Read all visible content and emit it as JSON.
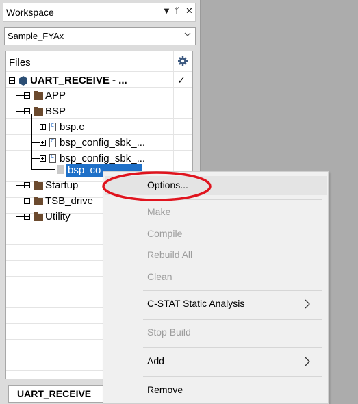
{
  "workspace": {
    "title": "Workspace",
    "controls": [
      "▼",
      "ᛘ",
      "✕"
    ],
    "config_value": "Sample_FYAx"
  },
  "files_panel": {
    "header": "Files",
    "gear_icon": "gear-icon",
    "project": {
      "label": "UART_RECEIVE - ...",
      "check": "✓"
    },
    "tree": [
      {
        "label": "APP"
      },
      {
        "label": "BSP"
      },
      {
        "label": "bsp.c"
      },
      {
        "label": "bsp_config_sbk_..."
      },
      {
        "label": "bsp_config_sbk_..."
      },
      {
        "label": "bsp_co"
      },
      {
        "label": "Startup"
      },
      {
        "label": "TSB_drive"
      },
      {
        "label": "Utility"
      }
    ]
  },
  "bottom_tab": {
    "label": "UART_RECEIVE"
  },
  "context_menu": {
    "items": [
      {
        "label": "Options...",
        "enabled": true
      },
      {
        "label": "Make",
        "enabled": false
      },
      {
        "label": "Compile",
        "enabled": false
      },
      {
        "label": "Rebuild All",
        "enabled": false
      },
      {
        "label": "Clean",
        "enabled": false
      },
      {
        "label": "C-STAT Static Analysis",
        "enabled": true,
        "submenu": true
      },
      {
        "label": "Stop Build",
        "enabled": false
      },
      {
        "label": "Add",
        "enabled": true,
        "submenu": true
      },
      {
        "label": "Remove",
        "enabled": true
      }
    ]
  },
  "colors": {
    "selection": "#1e70c8",
    "highlight_ellipse": "#e0141e",
    "folder": "#6b4a2e"
  }
}
